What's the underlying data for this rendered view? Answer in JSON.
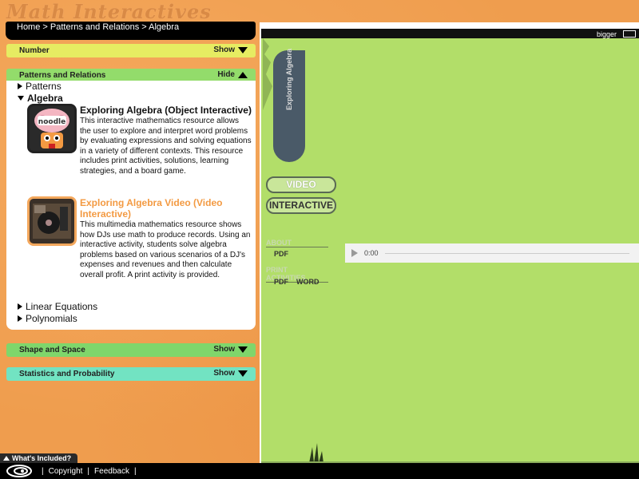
{
  "site_title": "Math Interactives",
  "breadcrumb": {
    "home": "Home",
    "sep1": ">",
    "level1": "Patterns and Relations",
    "sep2": ">",
    "level2": "Algebra"
  },
  "categories": [
    {
      "label": "Number",
      "toggle": "Show",
      "color": "#e6ec62"
    },
    {
      "label": "Patterns and Relations",
      "toggle": "Hide",
      "color": "#93dc6b"
    },
    {
      "label": "Shape and Space",
      "toggle": "Show",
      "color": "#7fd66b"
    },
    {
      "label": "Statistics and Probability",
      "toggle": "Show",
      "color": "#72e3c2"
    }
  ],
  "tree": {
    "patterns": "Patterns",
    "algebra": "Algebra",
    "linear_equations": "Linear Equations",
    "polynomials": "Polynomials"
  },
  "resources": [
    {
      "title": "Exploring Algebra (Object Interactive)",
      "description": "This interactive mathematics resource allows the user to explore and interpret word problems by evaluating expressions and solving equations in a variety of different contexts. This resource includes print activities, solutions, learning strategies, and a board game.",
      "thumb_icon": "noodle-icon",
      "thumb_text": "noodle"
    },
    {
      "title": "Exploring Algebra Video (Video Interactive)",
      "description": "This multimedia mathematics resource shows how DJs use math to produce records. Using an interactive activity, students solve algebra problems based on various scenarios of a DJ's expenses and revenues and then calculate overall profit. A print activity is provided.",
      "thumb_icon": "dj-turntable-icon"
    }
  ],
  "viewer": {
    "bigger_label": "bigger",
    "tab_title": "Exploring Algebra",
    "video_button": "VIDEO",
    "interactive_button": "INTERACTIVE",
    "about_heading": "ABOUT",
    "about_pdf": "PDF",
    "print_heading": "PRINT ACTIVITIES",
    "print_pdf": "PDF",
    "print_word": "WORD",
    "audio_time": "0:00"
  },
  "whats_included": "What's Included?",
  "footer": {
    "sep": "|",
    "copyright": "Copyright",
    "feedback": "Feedback"
  },
  "colors": {
    "accent_orange": "#f39a42",
    "stage_green": "#b2de69",
    "background": "#ef9d4e"
  }
}
